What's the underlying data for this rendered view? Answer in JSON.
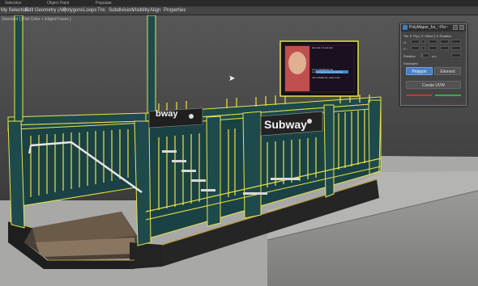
{
  "top_labels": [
    "Selection",
    "Object Paint",
    "Populate"
  ],
  "ribbon": {
    "items": [
      "My Selection",
      "Edit",
      "Geometry (All)",
      "Polygons",
      "Loops",
      "Tris",
      "Subdivision",
      "Visibility",
      "Align",
      "Properties"
    ]
  },
  "viewport": {
    "label": "Standard ] [Flat Color + Edged Faces ]",
    "sign_left": "bway",
    "sign_right": "Subway",
    "poster_lines": [
      "WELCOME TO A LIFE LESS",
      "WORLD PREMIERE AT THE",
      "NORTH INTERNATIONAL FILM FESTIVAL",
      "THE DOWNWAY WILL STAND DOWN"
    ]
  },
  "polymapper": {
    "title": "PolyMaper_for_~Flo~",
    "header": "Tile  ✕  Flip  [  ✕ Offset  ]  ✕  Rotation",
    "u_label": "U :",
    "v_label": "V :",
    "rotation_label": "Rotation",
    "rotation_value": "0",
    "ac_label": "a.c.",
    "sub_label": "Subobject",
    "polygon_button": "Polygon",
    "element_button": "Element",
    "create_button": "Create UVW",
    "colors": {
      "accent": "#4a7fc4",
      "red": "#d23030",
      "green": "#2fb34a"
    }
  }
}
